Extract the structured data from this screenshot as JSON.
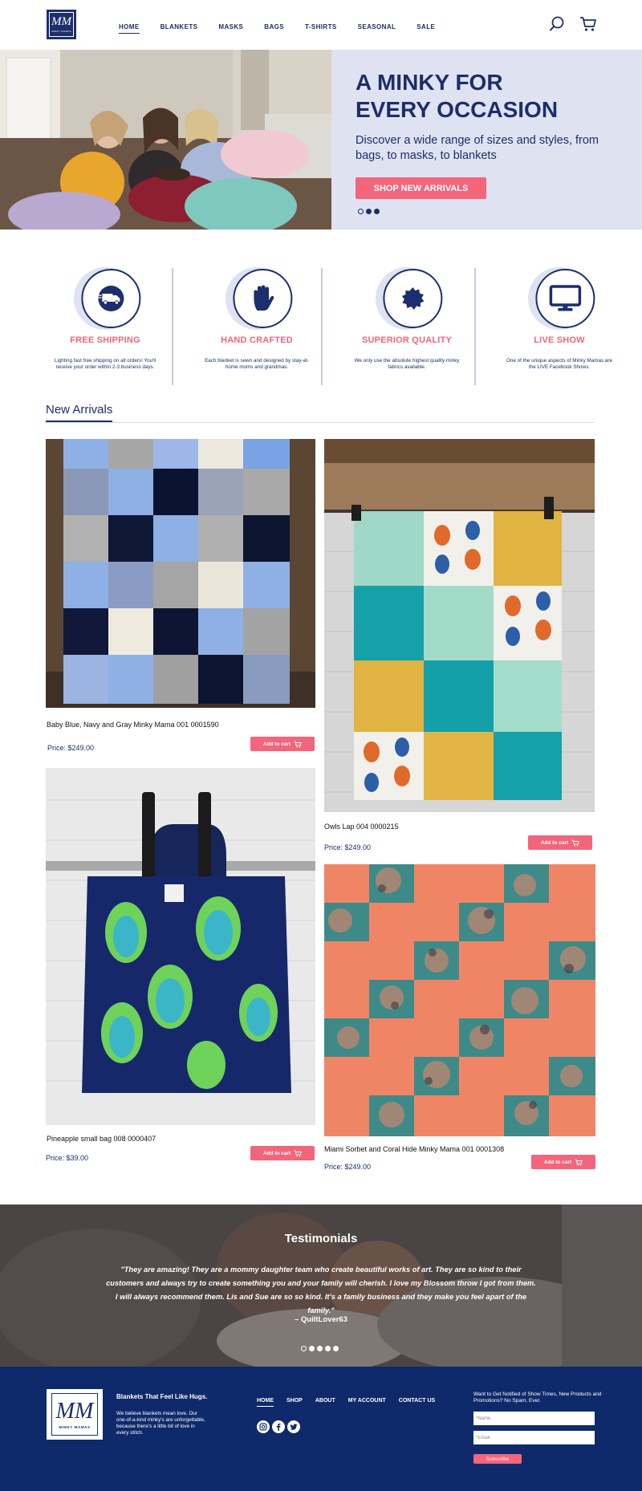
{
  "brand": {
    "logo_text": "MM",
    "logo_subtext": "MINKY MAMAS"
  },
  "nav": {
    "items": [
      {
        "label": "HOME",
        "active": true
      },
      {
        "label": "BLANKETS"
      },
      {
        "label": "MASKS"
      },
      {
        "label": "BAGS"
      },
      {
        "label": "T-SHIRTS"
      },
      {
        "label": "SEASONAL"
      },
      {
        "label": "SALE"
      }
    ],
    "icons": [
      "search-icon",
      "cart-icon"
    ]
  },
  "hero": {
    "title": "A MINKY FOR\nEVERY OCCASION",
    "subtitle": "Discover a wide range of sizes and styles, from bags, to masks, to blankets",
    "button_label": "SHOP NEW ARRIVALS",
    "slides": 3,
    "active_slide": 2
  },
  "features": [
    {
      "icon": "truck-icon",
      "title": "FREE SHIPPING",
      "description": "Lighting fast free shipping on all orders! You'll receive your order within 2-3 business days."
    },
    {
      "icon": "hand-icon",
      "title": "HAND CRAFTED",
      "description": "Each blanket is sewn and designed by stay-at-home moms and grandmas."
    },
    {
      "icon": "badge-icon",
      "title": "SUPERIOR QUALITY",
      "description": "We only use the absolute highest quality minky fabrics available."
    },
    {
      "icon": "monitor-icon",
      "title": "LIVE SHOW",
      "description": "One of the unique aspects of Minky Mamas are the LIVE Facebook Shows."
    }
  ],
  "new_arrivals": {
    "title": "New Arrivals",
    "cart_label": "Add to cart",
    "products": [
      {
        "name": "Baby Blue, Navy and Gray Minky Mama 001 0001590",
        "price": "Price: $249.00"
      },
      {
        "name": "Owls Lap 004 0000215",
        "price": "Price: $249.00"
      },
      {
        "name": "Pineapple small bag 008 0000407",
        "price": "Price: $39.00"
      },
      {
        "name": "Miami Sorbet and Coral Hide Minky Mama 001 0001308",
        "price": "Price: $249.00"
      }
    ]
  },
  "testimonials": {
    "title": "Testimonials",
    "quote": "\"They are amazing! They are a mommy daughter team who create beautiful works of art. They are so kind to their customers and always try to create something you and your family will cherish. I love my Blossom throw I got from them. I will always recommend them. Lis and Sue are so so kind. It's a family business and they make you feel apart of the family.\"",
    "author": "– QuiltLover63",
    "slides": 5,
    "active_slide": 1
  },
  "footer": {
    "tagline": "Blankets That Feel Like Hugs.",
    "about": "We believe blankets mean love. Our one-of-a-kind minky's are unforgettable, because there's a little bit of love in every stitch.",
    "nav": [
      {
        "label": "HOME",
        "active": true
      },
      {
        "label": "SHOP"
      },
      {
        "label": "ABOUT"
      },
      {
        "label": "MY ACCOUNT"
      },
      {
        "label": "CONTACT US"
      }
    ],
    "social": [
      "instagram-icon",
      "facebook-icon",
      "twitter-icon"
    ],
    "notify_text": "Want to Get Notified of Show Times, New Products and Promotions? No Spam, Ever.",
    "name_placeholder": "*Name",
    "email_placeholder": "*Email",
    "subscribe_label": "Subscribe"
  },
  "colors": {
    "navy": "#1c2e6b",
    "pink": "#f2657b",
    "lavender": "#dfe2f1",
    "footer": "#0f2a6b"
  }
}
